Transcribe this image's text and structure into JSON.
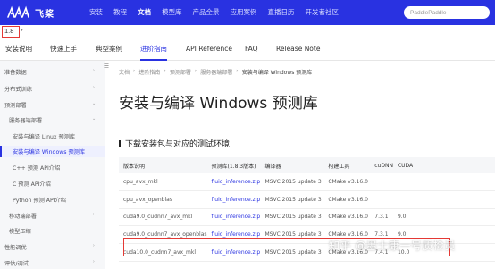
{
  "brand": {
    "name": "飞桨",
    "color": "#2932e1"
  },
  "nav": {
    "items": [
      {
        "label": "安装",
        "active": false
      },
      {
        "label": "教程",
        "active": false
      },
      {
        "label": "文档",
        "active": true
      },
      {
        "label": "模型库",
        "active": false
      },
      {
        "label": "产品全景",
        "active": false
      },
      {
        "label": "应用案例",
        "active": false
      },
      {
        "label": "直播日历",
        "active": false
      },
      {
        "label": "开发者社区",
        "active": false
      }
    ],
    "search_placeholder": "PaddlePaddle"
  },
  "version": {
    "value": "1.8"
  },
  "subtabs": [
    {
      "label": "安装说明",
      "active": false
    },
    {
      "label": "快速上手",
      "active": false
    },
    {
      "label": "典型案例",
      "active": false
    },
    {
      "label": "进阶指南",
      "active": true
    },
    {
      "label": "API Reference",
      "active": false
    },
    {
      "label": "FAQ",
      "active": false
    },
    {
      "label": "Release Note",
      "active": false
    }
  ],
  "sidebar": {
    "items": [
      {
        "label": "准备数据"
      },
      {
        "label": "分布式训练"
      },
      {
        "label": "预测部署"
      },
      {
        "label": "服务器端部署"
      },
      {
        "label": "安装与编译 Linux 预测库"
      },
      {
        "label": "安装与编译 Windows 预测库"
      },
      {
        "label": "C++ 预测 API介绍"
      },
      {
        "label": "C 预测 API介绍"
      },
      {
        "label": "Python 预测 API介绍"
      },
      {
        "label": "移动端部署"
      },
      {
        "label": "模型压缩"
      },
      {
        "label": "性能调优"
      },
      {
        "label": "评估/调试"
      }
    ]
  },
  "breadcrumb": [
    "文档",
    "进阶指南",
    "预测部署",
    "服务器端部署",
    "安装与编译 Windows 预测库"
  ],
  "page_title": "安装与编译 Windows 预测库",
  "section_title": "下载安装包与对应的测试环境",
  "table": {
    "headers": [
      "版本说明",
      "预测库(1.8.3版本)",
      "编译器",
      "构建工具",
      "cuDNN",
      "CUDA"
    ],
    "rows": [
      [
        "cpu_avx_mkl",
        "fluid_inference.zip",
        "MSVC 2015 update 3",
        "CMake v3.16.0",
        "",
        ""
      ],
      [
        "cpu_avx_openblas",
        "fluid_inference.zip",
        "MSVC 2015 update 3",
        "CMake v3.16.0",
        "",
        ""
      ],
      [
        "cuda9.0_cudnn7_avx_mkl",
        "fluid_inference.zip",
        "MSVC 2015 update 3",
        "CMake v3.16.0",
        "7.3.1",
        "9.0"
      ],
      [
        "cuda9.0_cudnn7_avx_openblas",
        "fluid_inference.zip",
        "MSVC 2015 update 3",
        "CMake v3.16.0",
        "7.3.1",
        "9.0"
      ],
      [
        "cuda10.0_cudnn7_avx_mkl",
        "fluid_inference.zip",
        "MSVC 2015 update 3",
        "CMake v3.16.0",
        "7.4.1",
        "10.0"
      ]
    ]
  },
  "watermark": "知乎 @墨士康一号质检员",
  "colors": {
    "accent": "#2932e1",
    "highlight": "#e53935",
    "sidebar_bg": "#f6f7f9"
  }
}
